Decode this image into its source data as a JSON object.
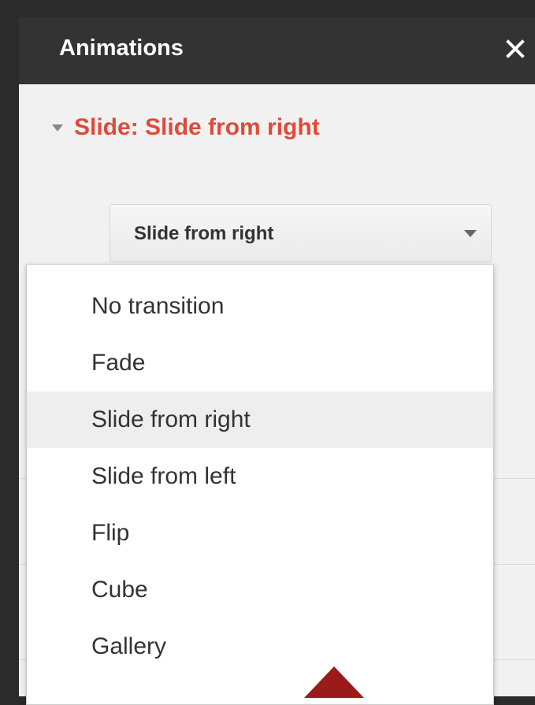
{
  "panel": {
    "title": "Animations",
    "close_icon": "close-icon",
    "section": {
      "icon": "triangle-down-icon",
      "label": "Slide: Slide from right"
    }
  },
  "transition_select": {
    "selected": "Slide from right",
    "icon": "dropdown-arrow-icon",
    "options": [
      {
        "label": "No transition",
        "selected": false
      },
      {
        "label": "Fade",
        "selected": false
      },
      {
        "label": "Slide from right",
        "selected": true
      },
      {
        "label": "Slide from left",
        "selected": false
      },
      {
        "label": "Flip",
        "selected": false
      },
      {
        "label": "Cube",
        "selected": false
      },
      {
        "label": "Gallery",
        "selected": false
      }
    ]
  },
  "colors": {
    "header_bg": "#333333",
    "accent": "#dd4b39",
    "highlight_bg": "#eeeeee",
    "pointer": "#9b1b1b"
  }
}
